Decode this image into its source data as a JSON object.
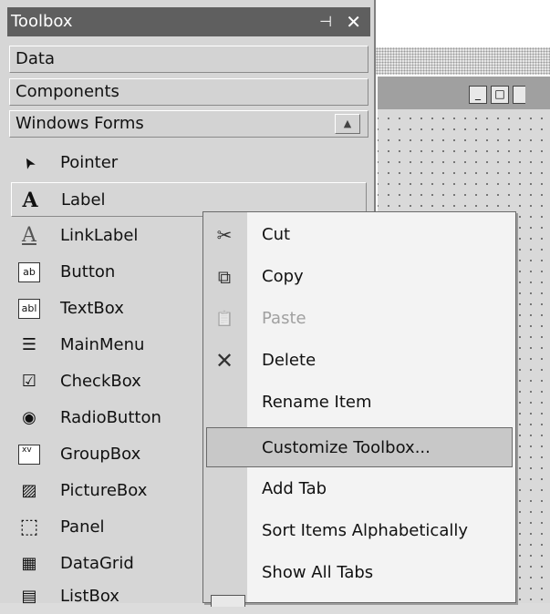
{
  "toolbox": {
    "title": "Toolbox",
    "pin_glyph": "⊣",
    "close_glyph": "✕",
    "tabs": [
      {
        "label": "Data"
      },
      {
        "label": "Components"
      },
      {
        "label": "Windows Forms",
        "scroll_glyph": "▲"
      }
    ],
    "items": [
      {
        "label": "Pointer",
        "icon": "pointer-icon",
        "glyph": "➤"
      },
      {
        "label": "Label",
        "icon": "label-icon",
        "glyph": "A"
      },
      {
        "label": "LinkLabel",
        "icon": "linklabel-icon",
        "glyph": "A"
      },
      {
        "label": "Button",
        "icon": "button-icon",
        "glyph": "ab"
      },
      {
        "label": "TextBox",
        "icon": "textbox-icon",
        "glyph": "abl"
      },
      {
        "label": "MainMenu",
        "icon": "mainmenu-icon",
        "glyph": "☰"
      },
      {
        "label": "CheckBox",
        "icon": "checkbox-icon",
        "glyph": "☑"
      },
      {
        "label": "RadioButton",
        "icon": "radiobutton-icon",
        "glyph": "◉"
      },
      {
        "label": "GroupBox",
        "icon": "groupbox-icon",
        "glyph": "xv"
      },
      {
        "label": "PictureBox",
        "icon": "picturebox-icon",
        "glyph": "▨"
      },
      {
        "label": "Panel",
        "icon": "panel-icon",
        "glyph": "⬚"
      },
      {
        "label": "DataGrid",
        "icon": "datagrid-icon",
        "glyph": "▦"
      },
      {
        "label": "ListBox",
        "icon": "listbox-icon",
        "glyph": "▤"
      }
    ]
  },
  "designer": {
    "minimize_glyph": "_",
    "maximize_glyph": "□"
  },
  "context_menu": {
    "items": [
      {
        "label": "Cut",
        "icon": "scissors-icon",
        "glyph": "✂",
        "disabled": false
      },
      {
        "label": "Copy",
        "icon": "copy-icon",
        "glyph": "⧉",
        "disabled": false
      },
      {
        "label": "Paste",
        "icon": "paste-icon",
        "glyph": "📋",
        "disabled": true
      },
      {
        "label": "Delete",
        "icon": "delete-icon",
        "glyph": "✕",
        "disabled": false
      },
      {
        "label": "Rename Item",
        "icon": "",
        "glyph": "",
        "disabled": false
      },
      {
        "label": "Customize Toolbox...",
        "icon": "",
        "glyph": "",
        "disabled": false,
        "highlighted": true
      },
      {
        "label": "Add Tab",
        "icon": "",
        "glyph": "",
        "disabled": false
      },
      {
        "label": "Sort Items Alphabetically",
        "icon": "",
        "glyph": "",
        "disabled": false
      },
      {
        "label": "Show All Tabs",
        "icon": "",
        "glyph": "",
        "disabled": false
      }
    ]
  }
}
